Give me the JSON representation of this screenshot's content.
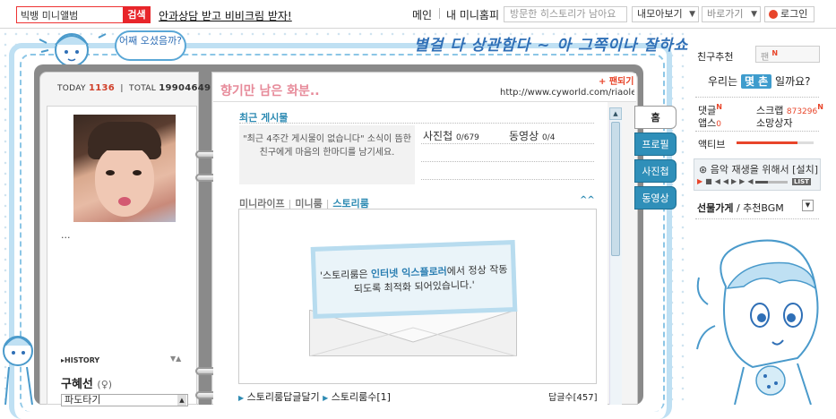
{
  "topbar": {
    "search_value": "빅뱅 미니앨범",
    "search_button": "검색",
    "promo": "안과상담 받고 비비크림 받자!",
    "nav_main": "메인",
    "nav_my_home": "내 미니홈피",
    "visited_history": "방문한 히스토리가 남아요",
    "collect_view": "내모아보기",
    "shortcut": "바로가기",
    "login": "로그인"
  },
  "decor": {
    "banner": "별걸 다 상관함다 ~ 아 그쪽이나 잘하쇼 !!",
    "cloud": "어째 오셨음까?"
  },
  "left_page": {
    "today_label": "TODAY",
    "today_count": "1136",
    "total_label": "TOTAL",
    "total_count": "19904649",
    "profile_text": "...",
    "history_label": "HISTORY",
    "name": "구혜선",
    "name_suffix": "(♀)",
    "mood": "파도타기"
  },
  "right_page": {
    "title": "향기만 남은 화분..",
    "paedo": "+ 팬되기",
    "url": "http://www.cyworld.com/riaolet",
    "recent_posts_title": "최근 게시물",
    "empty_message": "\"최근 4주간 게시물이 없습니다\" 소식이 뜸한 친구에게 마음의 한마디를 남기세요.",
    "photo_label": "사진첩",
    "photo_value": "0/679",
    "video_label": "동영상",
    "video_value": "0/4",
    "tabs": [
      "미니라이프",
      "미니룸",
      "스토리룸"
    ],
    "story_msg_pre": "'스토리룸은 ",
    "story_msg_bold": "인터넷 익스플로러",
    "story_msg_post": "에서 정상 작동되도록 최적화 되어있습니다.'",
    "footer_reply": "스토리룸답글달기",
    "footer_count": "스토리룸수[1]",
    "reply_count": "답글수[457]"
  },
  "side_tabs": [
    "홈",
    "프로필",
    "사진첩",
    "동영상"
  ],
  "right_panel": {
    "friend_rec": "친구추천",
    "friend_input": "팬",
    "question_pre": "우리는",
    "question_badge": "몇 촌",
    "question_post": "일까요?",
    "comments": "댓글",
    "scrap": "스크랩",
    "scrap_count": "873296",
    "apps": "앱스",
    "apps_count": "0",
    "app_name": "소망상자",
    "active": "액티브",
    "player_text": "음악 재생을 위해서 [설치]",
    "list": "LIST",
    "gift": "선물가게",
    "gift_sub": "/ 추천BGM"
  },
  "colors": {
    "accent": "#2f8fb9",
    "red": "#e8252a",
    "title_pink": "#e78b9a",
    "frame_blue": "#bfe0f3"
  }
}
